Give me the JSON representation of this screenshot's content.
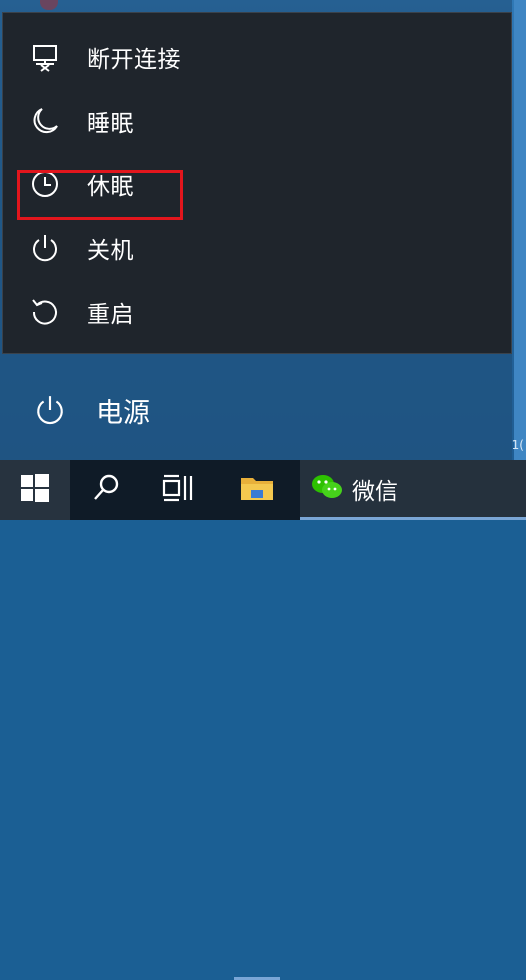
{
  "power_menu": {
    "items": [
      {
        "label": "断开连接",
        "icon": "disconnect-icon"
      },
      {
        "label": "睡眠",
        "icon": "moon-icon"
      },
      {
        "label": "休眠",
        "icon": "clock-icon",
        "highlighted": true
      },
      {
        "label": "关机",
        "icon": "power-icon"
      },
      {
        "label": "重启",
        "icon": "restart-icon"
      }
    ],
    "highlight_color": "#e2161d"
  },
  "start_menu": {
    "power_label": "电源"
  },
  "taskbar": {
    "wechat_label": "微信",
    "items": [
      "start-button",
      "search-button",
      "task-view-button",
      "file-explorer-button",
      "wechat-button"
    ]
  },
  "desktop": {
    "edge_text": "1("
  },
  "colors": {
    "flyout_bg": "#1f252c",
    "taskbar_bg": "#0f1b27",
    "accent_underline": "#7aa6d6",
    "text": "#ffffff"
  }
}
